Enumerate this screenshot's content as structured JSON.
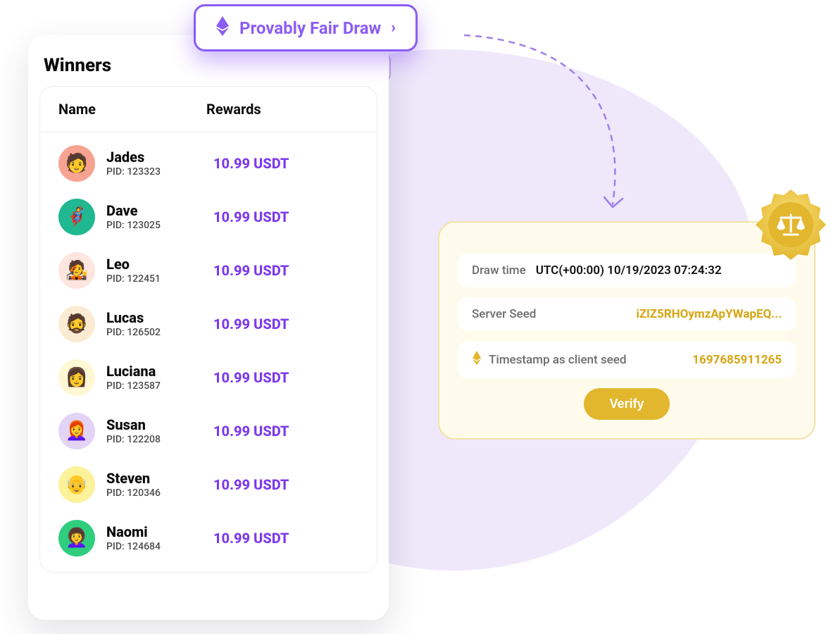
{
  "winners": {
    "title": "Winners",
    "headers": {
      "name": "Name",
      "rewards": "Rewards"
    },
    "pid_prefix": "PID: ",
    "rows": [
      {
        "name": "Jades",
        "pid": "123323",
        "reward": "10.99 USDT",
        "avatar_bg": "#F8A291",
        "emoji": "🧑"
      },
      {
        "name": "Dave",
        "pid": "123025",
        "reward": "10.99 USDT",
        "avatar_bg": "#1FB890",
        "emoji": "🦸"
      },
      {
        "name": "Leo",
        "pid": "122451",
        "reward": "10.99 USDT",
        "avatar_bg": "#FEE5DE",
        "emoji": "🧑‍🎤"
      },
      {
        "name": "Lucas",
        "pid": "126502",
        "reward": "10.99 USDT",
        "avatar_bg": "#FCEBD3",
        "emoji": "🧔"
      },
      {
        "name": "Luciana",
        "pid": "123587",
        "reward": "10.99 USDT",
        "avatar_bg": "#FFF8D4",
        "emoji": "👩"
      },
      {
        "name": "Susan",
        "pid": "122208",
        "reward": "10.99 USDT",
        "avatar_bg": "#E3D4F7",
        "emoji": "👩‍🦰"
      },
      {
        "name": "Steven",
        "pid": "120346",
        "reward": "10.99 USDT",
        "avatar_bg": "#FBF29A",
        "emoji": "👴"
      },
      {
        "name": "Naomi",
        "pid": "124684",
        "reward": "10.99 USDT",
        "avatar_bg": "#2FCD7E",
        "emoji": "👩‍🦱"
      }
    ]
  },
  "pf_badge": {
    "label": "Provably Fair Draw"
  },
  "verify": {
    "draw_time_label": "Draw time",
    "draw_time_value": "UTC(+00:00) 10/19/2023 07:24:32",
    "server_seed_label": "Server Seed",
    "server_seed_value": "iZlZ5RHOymzApYWapEQ...",
    "timestamp_label": "Timestamp as client seed",
    "timestamp_value": "1697685911265",
    "verify_button": "Verify"
  },
  "colors": {
    "accent_purple": "#8B5CF6",
    "accent_gold": "#E2B72E"
  }
}
